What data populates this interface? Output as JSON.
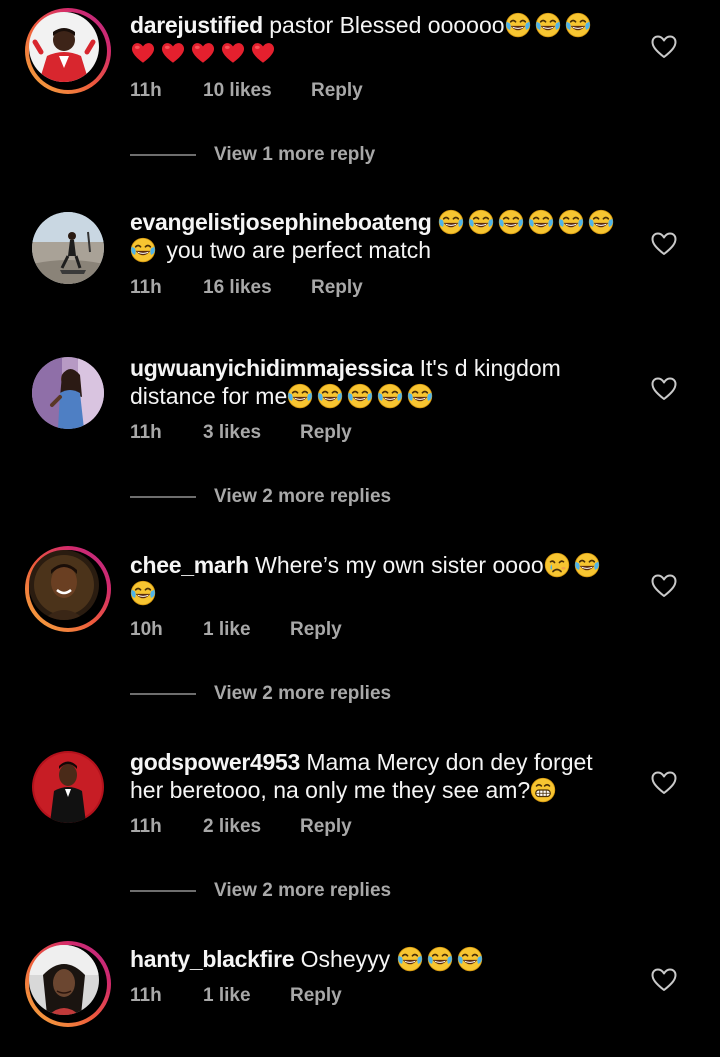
{
  "colors": {
    "background": "#000000",
    "text_primary": "#f5f5f5",
    "text_secondary": "#a8a8a8",
    "story_ring": [
      "#f6b23e",
      "#ee5a3c",
      "#d22a6c",
      "#b52a8c"
    ]
  },
  "comments": [
    {
      "username": "darejustified",
      "text": "pastor Blessed oooooo",
      "trailing_emojis": [
        "joy-emoji",
        "joy-emoji",
        "joy-emoji"
      ],
      "second_line_emojis": [
        "red-heart-emoji",
        "red-heart-emoji",
        "red-heart-emoji",
        "red-heart-emoji",
        "red-heart-emoji"
      ],
      "time": "11h",
      "likes": "10 likes",
      "reply_label": "Reply",
      "view_replies": "View 1 more reply",
      "has_story_ring": true,
      "like_icon": "heart-outline-icon"
    },
    {
      "username": "evangelistjosephineboateng",
      "text": "you two are perfect match",
      "time": "11h",
      "likes": "16 likes",
      "reply_label": "Reply",
      "has_story_ring": false,
      "like_icon": "heart-outline-icon"
    },
    {
      "username": "ugwuanyichidimmajessica",
      "text_line1": "It's d kingdom",
      "text_line2": "distance for me",
      "time": "11h",
      "likes": "3 likes",
      "reply_label": "Reply",
      "view_replies": "View 2 more replies",
      "has_story_ring": false,
      "like_icon": "heart-outline-icon"
    },
    {
      "username": "chee_marh",
      "text": "Where’s my own sister oooo",
      "time": "10h",
      "likes": "1 like",
      "reply_label": "Reply",
      "view_replies": "View 2 more replies",
      "has_story_ring": true,
      "like_icon": "heart-outline-icon"
    },
    {
      "username": "godspower4953",
      "text_line1": "Mama Mercy don dey forget",
      "text_line2": "her beretooo, na only me they see am?",
      "time": "11h",
      "likes": "2 likes",
      "reply_label": "Reply",
      "view_replies": "View 2 more replies",
      "has_story_ring": false,
      "like_icon": "heart-outline-icon"
    },
    {
      "username": "hanty_blackfire",
      "text": "Osheyyy",
      "time": "11h",
      "likes": "1 like",
      "reply_label": "Reply",
      "has_story_ring": true,
      "like_icon": "heart-outline-icon"
    }
  ]
}
